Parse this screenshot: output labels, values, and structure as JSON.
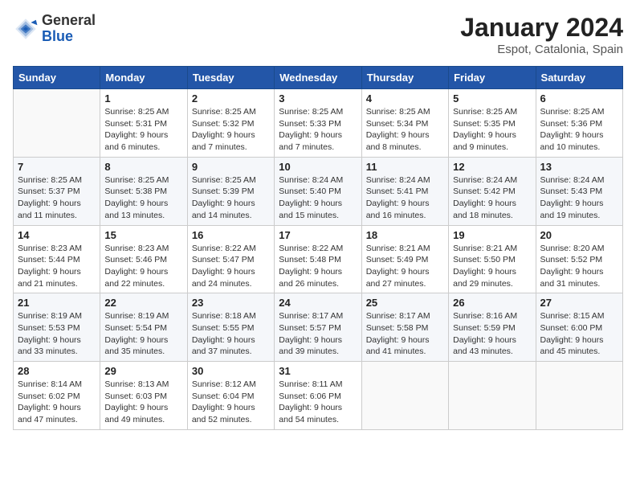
{
  "header": {
    "logo_general": "General",
    "logo_blue": "Blue",
    "month_year": "January 2024",
    "location": "Espot, Catalonia, Spain"
  },
  "calendar": {
    "days_of_week": [
      "Sunday",
      "Monday",
      "Tuesday",
      "Wednesday",
      "Thursday",
      "Friday",
      "Saturday"
    ],
    "weeks": [
      [
        {
          "day": "",
          "info": ""
        },
        {
          "day": "1",
          "info": "Sunrise: 8:25 AM\nSunset: 5:31 PM\nDaylight: 9 hours\nand 6 minutes."
        },
        {
          "day": "2",
          "info": "Sunrise: 8:25 AM\nSunset: 5:32 PM\nDaylight: 9 hours\nand 7 minutes."
        },
        {
          "day": "3",
          "info": "Sunrise: 8:25 AM\nSunset: 5:33 PM\nDaylight: 9 hours\nand 7 minutes."
        },
        {
          "day": "4",
          "info": "Sunrise: 8:25 AM\nSunset: 5:34 PM\nDaylight: 9 hours\nand 8 minutes."
        },
        {
          "day": "5",
          "info": "Sunrise: 8:25 AM\nSunset: 5:35 PM\nDaylight: 9 hours\nand 9 minutes."
        },
        {
          "day": "6",
          "info": "Sunrise: 8:25 AM\nSunset: 5:36 PM\nDaylight: 9 hours\nand 10 minutes."
        }
      ],
      [
        {
          "day": "7",
          "info": "Sunrise: 8:25 AM\nSunset: 5:37 PM\nDaylight: 9 hours\nand 11 minutes."
        },
        {
          "day": "8",
          "info": "Sunrise: 8:25 AM\nSunset: 5:38 PM\nDaylight: 9 hours\nand 13 minutes."
        },
        {
          "day": "9",
          "info": "Sunrise: 8:25 AM\nSunset: 5:39 PM\nDaylight: 9 hours\nand 14 minutes."
        },
        {
          "day": "10",
          "info": "Sunrise: 8:24 AM\nSunset: 5:40 PM\nDaylight: 9 hours\nand 15 minutes."
        },
        {
          "day": "11",
          "info": "Sunrise: 8:24 AM\nSunset: 5:41 PM\nDaylight: 9 hours\nand 16 minutes."
        },
        {
          "day": "12",
          "info": "Sunrise: 8:24 AM\nSunset: 5:42 PM\nDaylight: 9 hours\nand 18 minutes."
        },
        {
          "day": "13",
          "info": "Sunrise: 8:24 AM\nSunset: 5:43 PM\nDaylight: 9 hours\nand 19 minutes."
        }
      ],
      [
        {
          "day": "14",
          "info": "Sunrise: 8:23 AM\nSunset: 5:44 PM\nDaylight: 9 hours\nand 21 minutes."
        },
        {
          "day": "15",
          "info": "Sunrise: 8:23 AM\nSunset: 5:46 PM\nDaylight: 9 hours\nand 22 minutes."
        },
        {
          "day": "16",
          "info": "Sunrise: 8:22 AM\nSunset: 5:47 PM\nDaylight: 9 hours\nand 24 minutes."
        },
        {
          "day": "17",
          "info": "Sunrise: 8:22 AM\nSunset: 5:48 PM\nDaylight: 9 hours\nand 26 minutes."
        },
        {
          "day": "18",
          "info": "Sunrise: 8:21 AM\nSunset: 5:49 PM\nDaylight: 9 hours\nand 27 minutes."
        },
        {
          "day": "19",
          "info": "Sunrise: 8:21 AM\nSunset: 5:50 PM\nDaylight: 9 hours\nand 29 minutes."
        },
        {
          "day": "20",
          "info": "Sunrise: 8:20 AM\nSunset: 5:52 PM\nDaylight: 9 hours\nand 31 minutes."
        }
      ],
      [
        {
          "day": "21",
          "info": "Sunrise: 8:19 AM\nSunset: 5:53 PM\nDaylight: 9 hours\nand 33 minutes."
        },
        {
          "day": "22",
          "info": "Sunrise: 8:19 AM\nSunset: 5:54 PM\nDaylight: 9 hours\nand 35 minutes."
        },
        {
          "day": "23",
          "info": "Sunrise: 8:18 AM\nSunset: 5:55 PM\nDaylight: 9 hours\nand 37 minutes."
        },
        {
          "day": "24",
          "info": "Sunrise: 8:17 AM\nSunset: 5:57 PM\nDaylight: 9 hours\nand 39 minutes."
        },
        {
          "day": "25",
          "info": "Sunrise: 8:17 AM\nSunset: 5:58 PM\nDaylight: 9 hours\nand 41 minutes."
        },
        {
          "day": "26",
          "info": "Sunrise: 8:16 AM\nSunset: 5:59 PM\nDaylight: 9 hours\nand 43 minutes."
        },
        {
          "day": "27",
          "info": "Sunrise: 8:15 AM\nSunset: 6:00 PM\nDaylight: 9 hours\nand 45 minutes."
        }
      ],
      [
        {
          "day": "28",
          "info": "Sunrise: 8:14 AM\nSunset: 6:02 PM\nDaylight: 9 hours\nand 47 minutes."
        },
        {
          "day": "29",
          "info": "Sunrise: 8:13 AM\nSunset: 6:03 PM\nDaylight: 9 hours\nand 49 minutes."
        },
        {
          "day": "30",
          "info": "Sunrise: 8:12 AM\nSunset: 6:04 PM\nDaylight: 9 hours\nand 52 minutes."
        },
        {
          "day": "31",
          "info": "Sunrise: 8:11 AM\nSunset: 6:06 PM\nDaylight: 9 hours\nand 54 minutes."
        },
        {
          "day": "",
          "info": ""
        },
        {
          "day": "",
          "info": ""
        },
        {
          "day": "",
          "info": ""
        }
      ]
    ]
  }
}
